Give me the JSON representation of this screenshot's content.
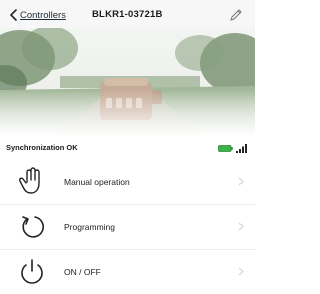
{
  "header": {
    "back_label": "Controllers",
    "title": "BLKR1-03721B"
  },
  "status": {
    "text": "Synchronization OK",
    "battery_color": "#3cb34a",
    "signal_icon": "signal-icon"
  },
  "menu": {
    "items": [
      {
        "label": "Manual operation",
        "icon": "hand-icon"
      },
      {
        "label": "Programming",
        "icon": "refresh-icon"
      },
      {
        "label": "ON / OFF",
        "icon": "power-icon"
      }
    ]
  },
  "colors": {
    "accent": "#1f2a33",
    "text": "#222222",
    "divider": "#eeeeee"
  }
}
